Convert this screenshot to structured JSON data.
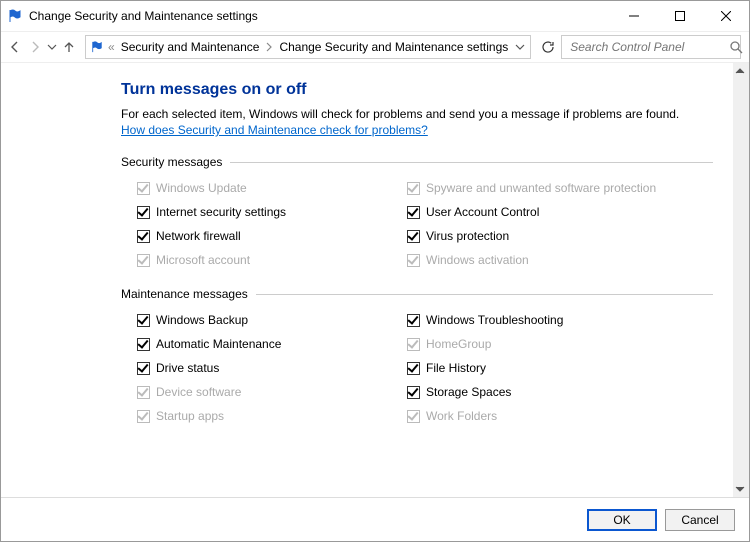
{
  "window": {
    "title": "Change Security and Maintenance settings"
  },
  "nav": {
    "breadcrumb_prefix": "«",
    "breadcrumb1": "Security and Maintenance",
    "breadcrumb2": "Change Security and Maintenance settings"
  },
  "search": {
    "placeholder": "Search Control Panel"
  },
  "page": {
    "heading": "Turn messages on or off",
    "description": "For each selected item, Windows will check for problems and send you a message if problems are found.",
    "help_link": "How does Security and Maintenance check for problems?"
  },
  "sections": {
    "security": {
      "title": "Security messages",
      "items": {
        "left": [
          {
            "label": "Windows Update",
            "checked": true,
            "disabled": true
          },
          {
            "label": "Internet security settings",
            "checked": true,
            "disabled": false
          },
          {
            "label": "Network firewall",
            "checked": true,
            "disabled": false
          },
          {
            "label": "Microsoft account",
            "checked": true,
            "disabled": true
          }
        ],
        "right": [
          {
            "label": "Spyware and unwanted software protection",
            "checked": true,
            "disabled": true
          },
          {
            "label": "User Account Control",
            "checked": true,
            "disabled": false
          },
          {
            "label": "Virus protection",
            "checked": true,
            "disabled": false
          },
          {
            "label": "Windows activation",
            "checked": true,
            "disabled": true
          }
        ]
      }
    },
    "maintenance": {
      "title": "Maintenance messages",
      "items": {
        "left": [
          {
            "label": "Windows Backup",
            "checked": true,
            "disabled": false
          },
          {
            "label": "Automatic Maintenance",
            "checked": true,
            "disabled": false
          },
          {
            "label": "Drive status",
            "checked": true,
            "disabled": false
          },
          {
            "label": "Device software",
            "checked": true,
            "disabled": true
          },
          {
            "label": "Startup apps",
            "checked": true,
            "disabled": true
          }
        ],
        "right": [
          {
            "label": "Windows Troubleshooting",
            "checked": true,
            "disabled": false
          },
          {
            "label": "HomeGroup",
            "checked": true,
            "disabled": true
          },
          {
            "label": "File History",
            "checked": true,
            "disabled": false
          },
          {
            "label": "Storage Spaces",
            "checked": true,
            "disabled": false
          },
          {
            "label": "Work Folders",
            "checked": true,
            "disabled": true
          }
        ]
      }
    }
  },
  "buttons": {
    "ok": "OK",
    "cancel": "Cancel"
  }
}
